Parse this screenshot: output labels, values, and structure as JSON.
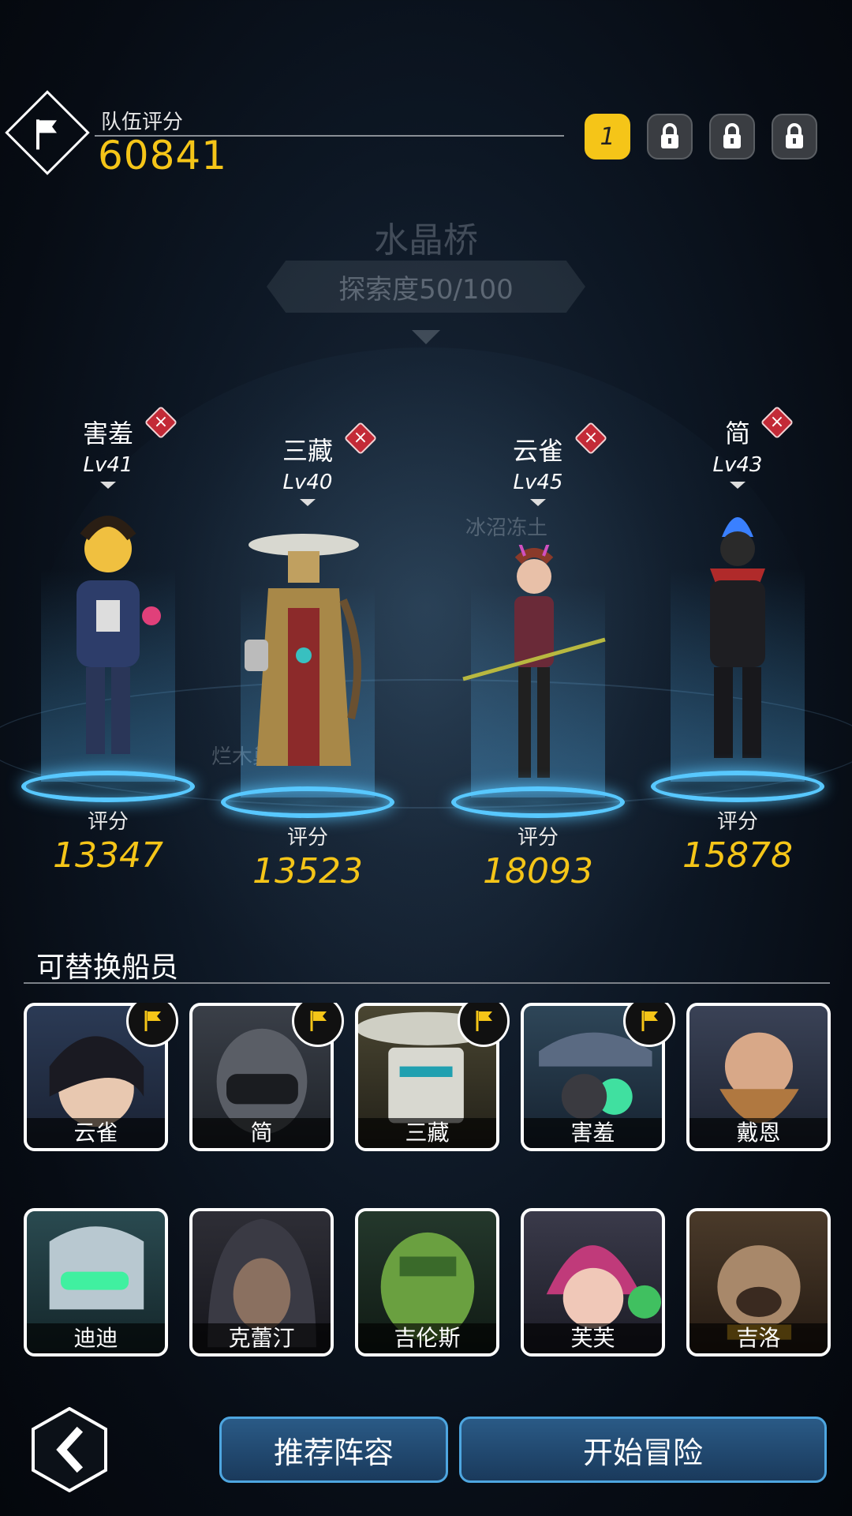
{
  "header": {
    "team_score_label": "队伍评分",
    "team_score": "60841",
    "team_slots": [
      {
        "label": "1",
        "state": "active"
      },
      {
        "label": "",
        "state": "locked",
        "icon": "lock-icon"
      },
      {
        "label": "",
        "state": "locked",
        "icon": "lock-icon"
      },
      {
        "label": "",
        "state": "locked",
        "icon": "lock-icon"
      }
    ]
  },
  "map": {
    "name": "水晶桥",
    "exploration": "探索度50/100",
    "tags": [
      "冰沼冻土",
      "烂木巢"
    ]
  },
  "heroes": [
    {
      "name": "害羞",
      "level": "Lv41",
      "score_label": "评分",
      "score": "13347",
      "remove": "×"
    },
    {
      "name": "三藏",
      "level": "Lv40",
      "score_label": "评分",
      "score": "13523",
      "remove": "×"
    },
    {
      "name": "云雀",
      "level": "Lv45",
      "score_label": "评分",
      "score": "18093",
      "remove": "×"
    },
    {
      "name": "简",
      "level": "Lv43",
      "score_label": "评分",
      "score": "15878",
      "remove": "×"
    }
  ],
  "crew": {
    "title": "可替换船员",
    "members": [
      {
        "name": "云雀",
        "in_team": true
      },
      {
        "name": "简",
        "in_team": true
      },
      {
        "name": "三藏",
        "in_team": true
      },
      {
        "name": "害羞",
        "in_team": true
      },
      {
        "name": "戴恩",
        "in_team": false
      },
      {
        "name": "迪迪",
        "in_team": false
      },
      {
        "name": "克蕾汀",
        "in_team": false
      },
      {
        "name": "吉伦斯",
        "in_team": false
      },
      {
        "name": "芙芙",
        "in_team": false
      },
      {
        "name": "吉洛",
        "in_team": false
      }
    ]
  },
  "footer": {
    "recommend_label": "推荐阵容",
    "start_label": "开始冒险"
  },
  "colors": {
    "accent_gold": "#f5c518",
    "pad_blue": "#58c8ff",
    "button_blue": "#2a5a86",
    "remove_red": "#c32a37"
  }
}
